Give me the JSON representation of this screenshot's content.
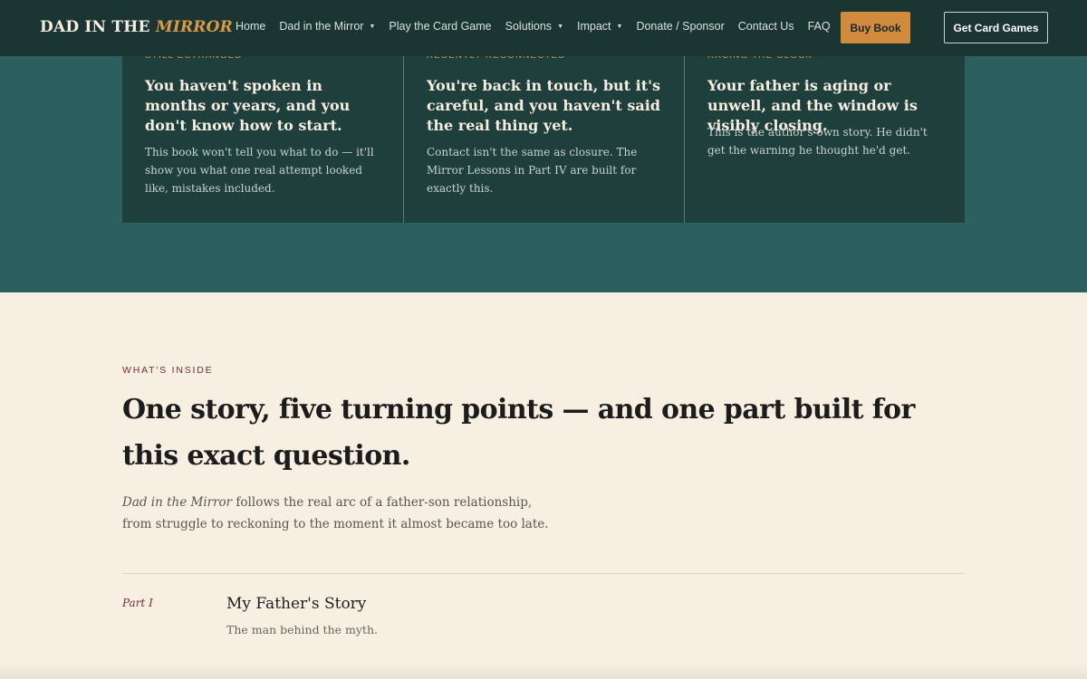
{
  "brand": {
    "name_part1": "DAD IN THE",
    "name_part2": "MIRROR"
  },
  "nav": {
    "items": [
      {
        "label": "Home",
        "has_dropdown": false
      },
      {
        "label": "Dad in the Mirror",
        "has_dropdown": true
      },
      {
        "label": "Play the Card Game",
        "has_dropdown": false
      },
      {
        "label": "Solutions",
        "has_dropdown": true
      },
      {
        "label": "Impact",
        "has_dropdown": true
      },
      {
        "label": "Donate / Sponsor",
        "has_dropdown": false
      },
      {
        "label": "Contact Us",
        "has_dropdown": false
      },
      {
        "label": "FAQ",
        "has_dropdown": false
      }
    ],
    "buy_label": "Buy Book",
    "cards_label": "Get Card Games"
  },
  "situations": [
    {
      "eyebrow": "STILL ESTRANGED",
      "title": "You haven't spoken in months or years, and you don't know how to start.",
      "body": "This book won't tell you what to do — it'll show you what one real attempt looked like, mistakes included."
    },
    {
      "eyebrow": "RECENTLY RECONNECTED",
      "title": "You're back in touch, but it's careful, and you haven't said the real thing yet.",
      "body": "Contact isn't the same as closure. The Mirror Lessons in Part IV are built for exactly this."
    },
    {
      "eyebrow": "RACING THE CLOCK",
      "title": "Your father is aging or unwell, and the window is visibly closing.",
      "body": "This is the author's own story. He didn't get the warning he thought he'd get."
    }
  ],
  "inside": {
    "eyebrow": "WHAT'S INSIDE",
    "headline": "One story, five turning points — and one part built for this exact question.",
    "lede_title": "Dad in the Mirror",
    "lede_rest": " follows the real arc of a father-son relationship, from struggle to reckoning to the moment it almost became too late.",
    "parts": [
      {
        "label": "Part I",
        "title": "My Father's Story",
        "subtitle": "The man behind the myth."
      }
    ]
  },
  "colors": {
    "nav_bg": "#1b3533",
    "teal_band": "#2c5f60",
    "card_bg": "#1f3f3d",
    "accent_gold": "#d08c3c",
    "cream": "#f6efe2",
    "eyebrow_maroon": "#7a2a35"
  }
}
